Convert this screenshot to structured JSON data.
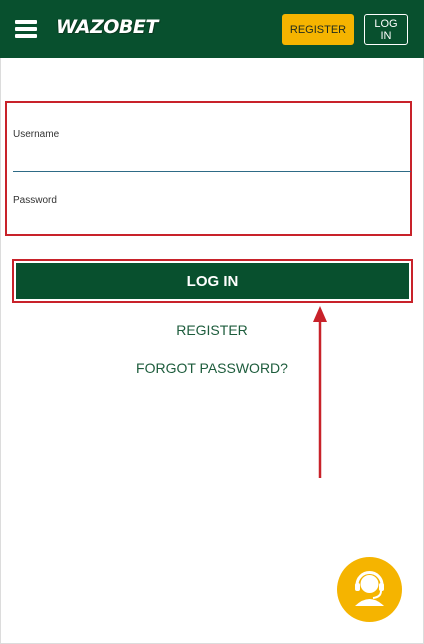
{
  "header": {
    "logo_text": "WAZOBET",
    "register_label": "REGISTER",
    "login_label": "LOG IN",
    "bg_color": "#08502e",
    "accent_color": "#f5b400"
  },
  "form": {
    "username_label": "Username",
    "username_value": "",
    "password_label": "Password",
    "password_value": "",
    "highlight_color": "#c8222a"
  },
  "main": {
    "login_button_label": "LOG IN",
    "register_link": "REGISTER",
    "forgot_link": "FORGOT PASSWORD?"
  },
  "icons": {
    "menu": "hamburger-menu-icon",
    "support": "headset-support-icon",
    "annotation": "red-arrow-up"
  }
}
